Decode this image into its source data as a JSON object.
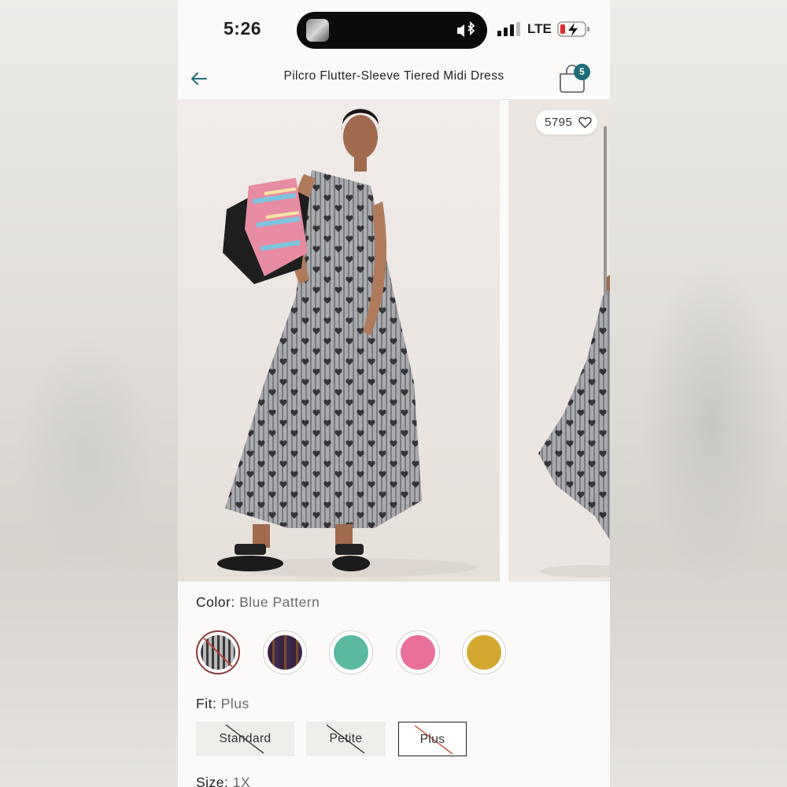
{
  "status_bar": {
    "time": "5:26",
    "network": "LTE"
  },
  "nav": {
    "title": "Pilcro Flutter-Sleeve Tiered Midi Dress",
    "bag_count": "5"
  },
  "gallery": {
    "likes": "5795"
  },
  "color": {
    "label": "Color:",
    "selected": "Blue Pattern",
    "swatches": [
      {
        "name": "Blue Pattern",
        "color": "#8c8c8c",
        "unavailable": true
      },
      {
        "name": "Plum Stripe",
        "color": "#4a3048"
      },
      {
        "name": "Mint",
        "color": "#5ab9a0"
      },
      {
        "name": "Pink",
        "color": "#e8709a"
      },
      {
        "name": "Gold",
        "color": "#d4a730"
      }
    ]
  },
  "fit": {
    "label": "Fit:",
    "selected": "Plus",
    "options": [
      "Standard",
      "Petite",
      "Plus"
    ]
  },
  "size": {
    "label": "Size:",
    "selected": "1X"
  },
  "colors": {
    "accent": "#1f6d78",
    "unavailable_slash": "#c0392b"
  }
}
